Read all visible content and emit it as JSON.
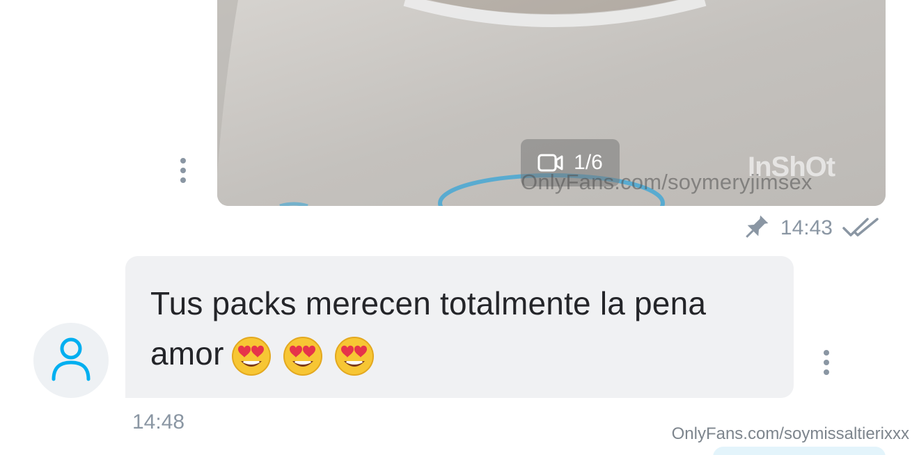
{
  "sent_message": {
    "media": {
      "counter_label": "1/6",
      "counter_icon": "video-camera-icon",
      "watermark": "OnlyFans.com/soymeryjimsex",
      "app_mark": "InShOt"
    },
    "pin_icon": "pin-icon",
    "time": "14:43",
    "status_icon": "double-check-icon"
  },
  "received_message": {
    "avatar_icon": "user-icon",
    "text": "Tus packs merecen totalmente la pena amor",
    "emojis": [
      "heart-eyes-emoji",
      "heart-eyes-emoji",
      "heart-eyes-emoji"
    ],
    "time": "14:48"
  },
  "footer": {
    "watermark": "OnlyFans.com/soymissaltierixxx"
  },
  "colors": {
    "accent": "#00aff0",
    "muted": "#8a96a3",
    "bubble_received": "#f0f1f3"
  }
}
